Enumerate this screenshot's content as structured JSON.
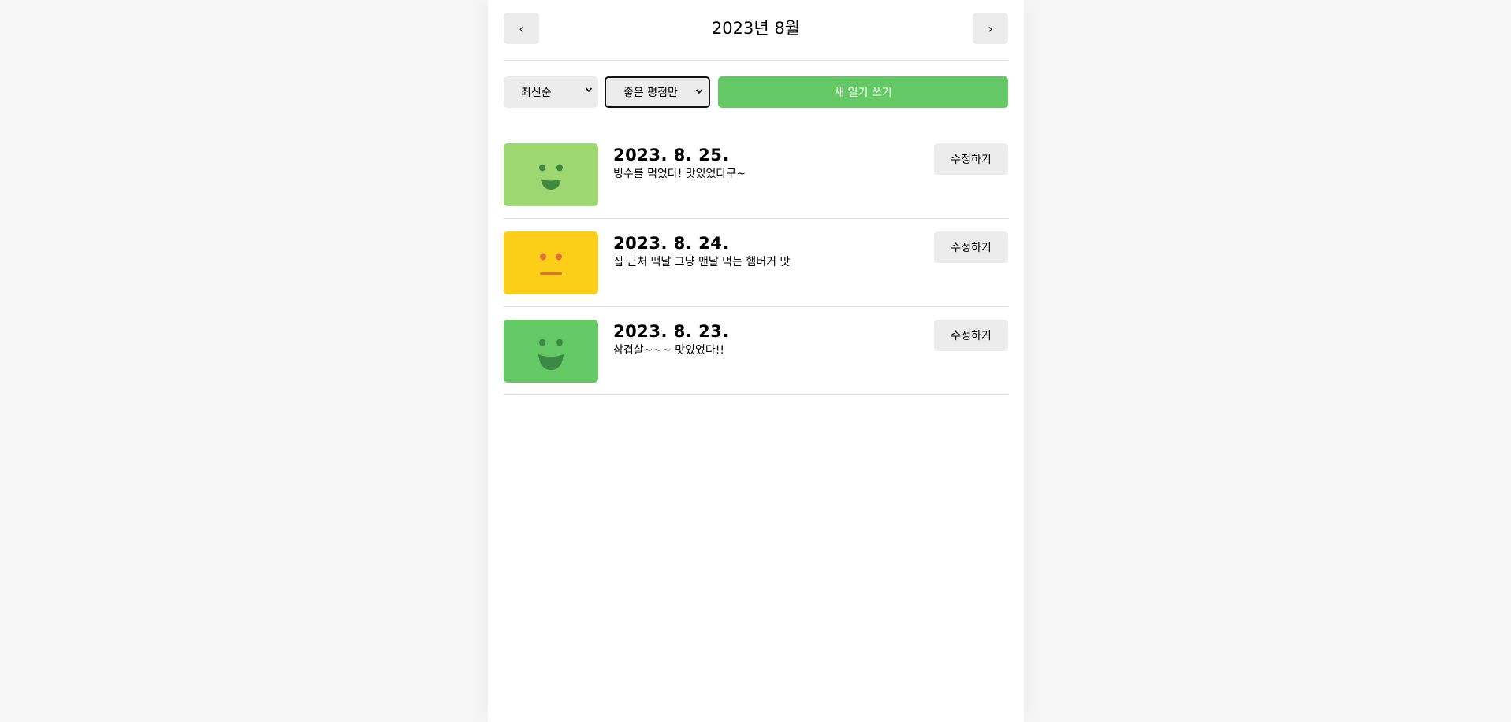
{
  "header": {
    "prev_label": "‹",
    "title": "2023년 8월",
    "next_label": "›"
  },
  "controls": {
    "sort_selected": "최신순",
    "filter_selected": "좋은 평점만",
    "new_button_label": "새 일기 쓰기"
  },
  "colors": {
    "accent_green": "#64c964",
    "emotion_1": "#64c964",
    "emotion_2": "#9dd772",
    "emotion_3": "#fdce17"
  },
  "diary_list": [
    {
      "date": "2023. 8. 25.",
      "content": "빙수를 먹었다! 맛있었다구~",
      "emotion_icon": "smile-face-icon",
      "emotion_color": "#9dd772",
      "edit_label": "수정하기"
    },
    {
      "date": "2023. 8. 24.",
      "content": "집 근처 맥날 그냥 맨날 먹는 햄버거 맛",
      "emotion_icon": "neutral-face-icon",
      "emotion_color": "#fdce17",
      "edit_label": "수정하기"
    },
    {
      "date": "2023. 8. 23.",
      "content": "삼겹살~~~ 맛있었다!!",
      "emotion_icon": "big-smile-face-icon",
      "emotion_color": "#64c964",
      "edit_label": "수정하기"
    }
  ]
}
